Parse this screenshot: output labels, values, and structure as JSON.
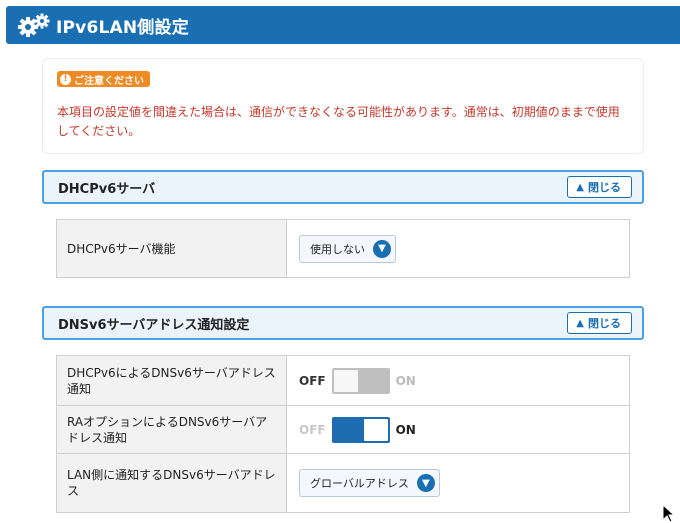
{
  "header": {
    "title": "IPv6LAN側設定",
    "icon": "gear-icon"
  },
  "caution": {
    "badge": "ご注意ください",
    "text": "本項目の設定値を間違えた場合は、通信ができなくなる可能性があります。通常は、初期値のままで使用してください。"
  },
  "sections": [
    {
      "title": "DHCPv6サーバ",
      "close_label": "閉じる",
      "rows": [
        {
          "label": "DHCPv6サーバ機能",
          "select_value": "使用しない"
        }
      ]
    },
    {
      "title": "DNSv6サーバアドレス通知設定",
      "close_label": "閉じる",
      "rows": [
        {
          "label": "DHCPv6によるDNSv6サーバアドレス通知",
          "off": "OFF",
          "on": "ON",
          "state": "off"
        },
        {
          "label": "RAオプションによるDNSv6サーバアドレス通知",
          "off": "OFF",
          "on": "ON",
          "state": "on"
        },
        {
          "label": "LAN側に通知するDNSv6サーバアドレス",
          "select_value": "グローバルアドレス"
        }
      ]
    }
  ],
  "colors": {
    "accent": "#1a6fb3",
    "caution": "#f08a24",
    "caution_text": "#c0392b",
    "section_border": "#4aa3e0"
  }
}
